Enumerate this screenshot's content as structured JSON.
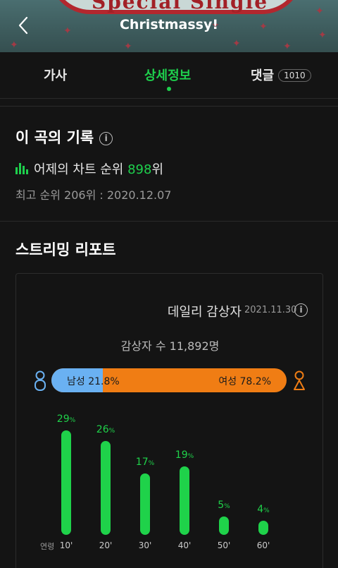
{
  "header": {
    "title": "Christmassy!",
    "art_text": "Special Single"
  },
  "tabs": [
    {
      "label": "가사"
    },
    {
      "label": "상세정보"
    },
    {
      "label": "댓글",
      "count": "1010"
    }
  ],
  "record": {
    "title": "이 곡의 기록",
    "chart_prefix": "어제의 차트 순위 ",
    "chart_rank": "898",
    "chart_suffix": "위",
    "best": "최고 순위 206위 : 2020.12.07"
  },
  "streaming": {
    "title": "스트리밍 리포트",
    "card_title": "데일리 감상자",
    "date": "2021.11.30",
    "listeners": "감상자 수 11,892명",
    "male_label": "남성 21.8%",
    "female_label": "여성 78.2%",
    "male_pct": 21.8,
    "colors": {
      "male": "#6ab1f2",
      "female": "#f07d14",
      "accent": "#1ed04d"
    },
    "age_axis_label": "연령",
    "ages": [
      {
        "label": "10'",
        "pct": 29
      },
      {
        "label": "20'",
        "pct": 26
      },
      {
        "label": "30'",
        "pct": 17
      },
      {
        "label": "40'",
        "pct": 19
      },
      {
        "label": "50'",
        "pct": 5
      },
      {
        "label": "60'",
        "pct": 4
      }
    ]
  }
}
